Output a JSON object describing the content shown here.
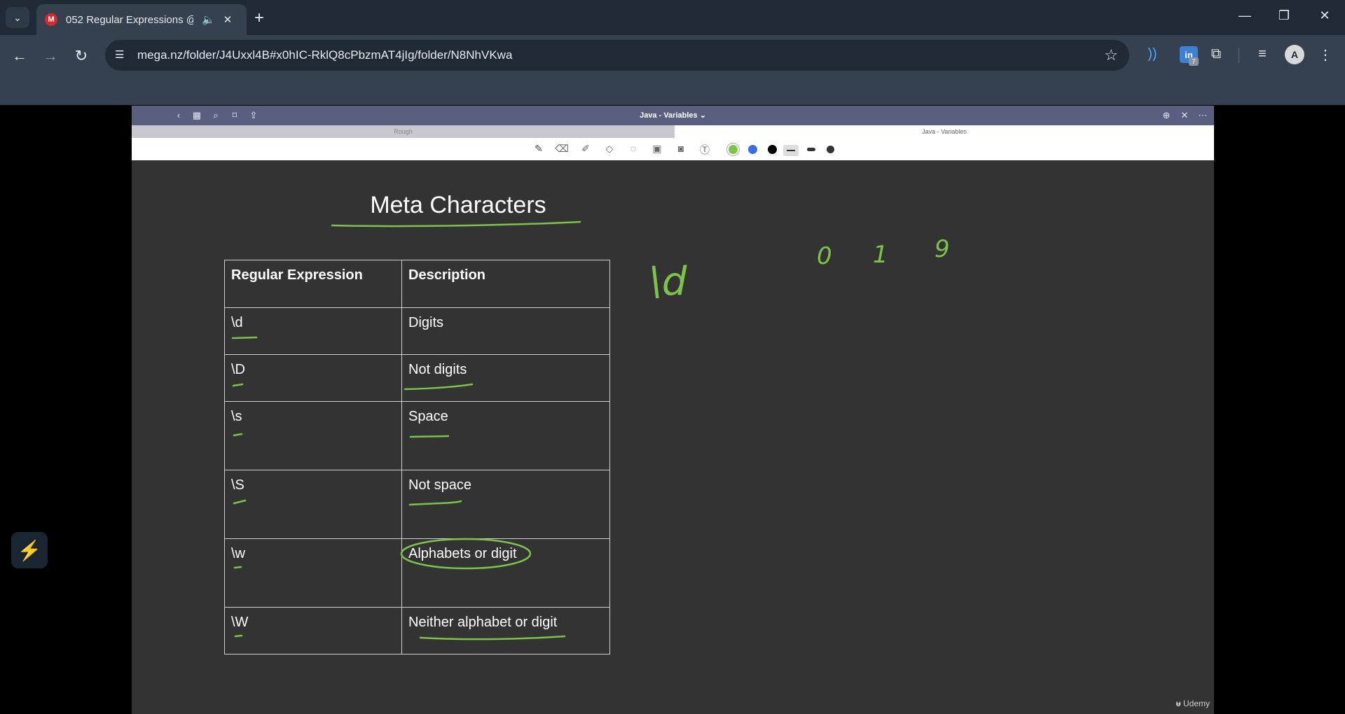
{
  "browser": {
    "tab_title": "052 Regular Expressions @",
    "favicon_letter": "M",
    "address": "mega.nz/folder/J4Uxxl4B#x0hIC-RklQ8cPbzmAT4jIg/folder/N8NhVKwa",
    "ext_badge_count": "7",
    "avatar_letter": "A"
  },
  "app": {
    "doc_title": "Java - Variables ⌄",
    "tab_rough": "Rough",
    "tab_java": "Java - Variables"
  },
  "slide": {
    "heading": "Meta Characters",
    "table": {
      "headers": [
        "Regular Expression",
        "Description"
      ],
      "rows": [
        [
          "\\d",
          "Digits"
        ],
        [
          "\\D",
          "Not digits"
        ],
        [
          "\\s",
          "Space"
        ],
        [
          "\\S",
          "Not space"
        ],
        [
          "\\w",
          "Alphabets or digit"
        ],
        [
          "\\W",
          "Neither alphabet or digit"
        ]
      ]
    },
    "handwriting": {
      "pattern": "\\d",
      "digits": [
        "0",
        "1",
        "9"
      ]
    },
    "watermark": "Udemy"
  },
  "colors": {
    "ink_green": "#7cc34a",
    "pen_blue": "#3b6fe0",
    "pen_black": "#000000"
  }
}
